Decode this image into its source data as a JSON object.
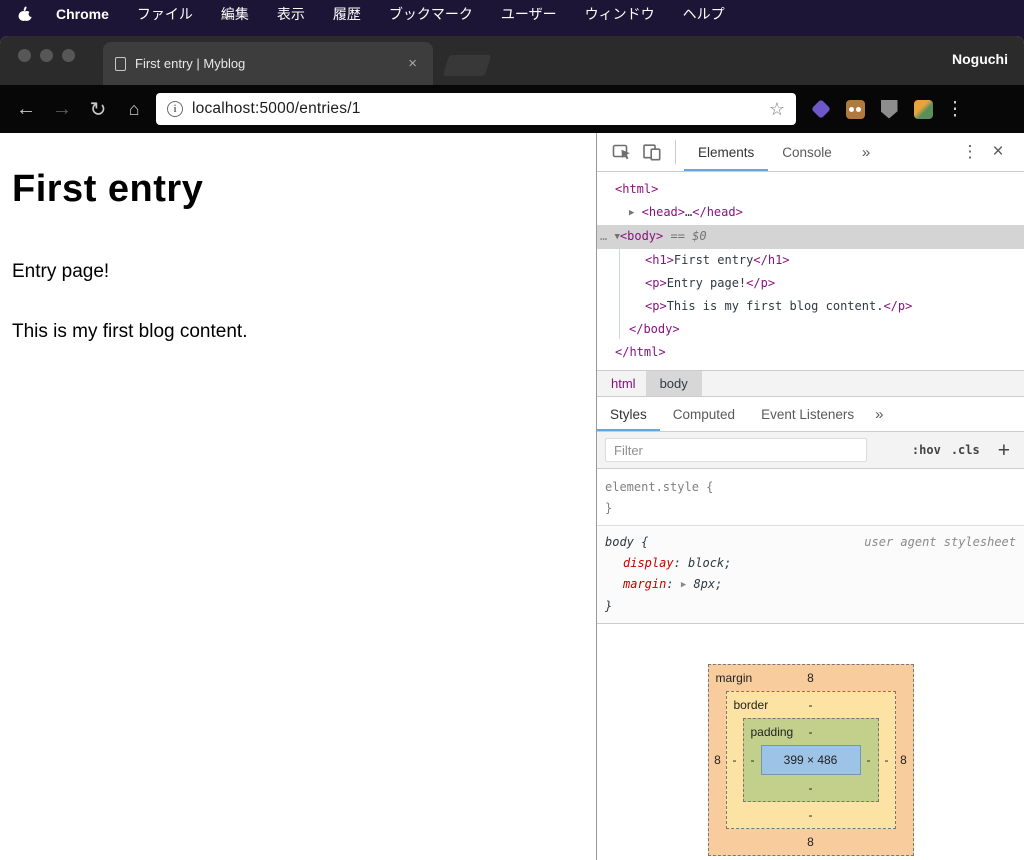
{
  "menubar": {
    "app_name": "Chrome",
    "items": [
      "ファイル",
      "編集",
      "表示",
      "履歴",
      "ブックマーク",
      "ユーザー",
      "ウィンドウ",
      "ヘルプ"
    ]
  },
  "window": {
    "tab_title": "First entry | Myblog",
    "tab_close": "×",
    "profile_name": "Noguchi"
  },
  "toolbar": {
    "url": "localhost:5000/entries/1",
    "icons": {
      "back": "←",
      "forward": "→",
      "reload": "↻",
      "home": "⌂",
      "info": "i",
      "star": "☆",
      "menu": "⋮"
    }
  },
  "page": {
    "title": "First entry",
    "paragraph1": "Entry page!",
    "paragraph2": "This is my first blog content."
  },
  "devtools": {
    "header": {
      "tab_elements": "Elements",
      "tab_console": "Console",
      "more": "»",
      "menu": "⋮",
      "close": "×"
    },
    "tree": {
      "html_open": "<html>",
      "head_arrow": "▶",
      "head_open": "<head>",
      "head_ellipsis": "…",
      "head_close": "</head>",
      "body_gutter": "…",
      "body_arrow": "▼",
      "body_open": "<body>",
      "body_hint": "== $0",
      "children": [
        {
          "open": "<h1>",
          "text": "First entry",
          "close": "</h1>"
        },
        {
          "open": "<p>",
          "text": "Entry page!",
          "close": "</p>"
        },
        {
          "open": "<p>",
          "text": "This is my first blog content.",
          "close": "</p>"
        }
      ],
      "body_close": "</body>",
      "html_close": "</html>"
    },
    "crumbs": [
      "html",
      "body"
    ],
    "styles_tabs": [
      "Styles",
      "Computed",
      "Event Listeners"
    ],
    "styles_more": "»",
    "filter": {
      "placeholder": "Filter",
      "hov": ":hov",
      "cls": ".cls",
      "plus": "+"
    },
    "element_style": {
      "selector": "element.style",
      "open": "{",
      "close": "}"
    },
    "body_rule": {
      "selector": "body {",
      "origin": "user agent stylesheet",
      "props": [
        {
          "name": "display",
          "colon": ": ",
          "value": "block;"
        },
        {
          "name": "margin",
          "colon": ": ",
          "arrow": "▶",
          "value": " 8px;"
        }
      ],
      "close": "}"
    },
    "box_model": {
      "margin_label": "margin",
      "border_label": "border",
      "padding_label": "padding",
      "content_text": "399 × 486",
      "margin": {
        "top": "8",
        "right": "8",
        "bottom": "8",
        "left": "8"
      },
      "border": {
        "top": "-",
        "right": "-",
        "bottom": "-",
        "left": "-"
      },
      "padding": {
        "top": "-",
        "right": "-",
        "bottom": "-",
        "left": "-"
      }
    },
    "colors": {
      "accent_tab_underline": "#62a7e6",
      "tag": "#881280",
      "property_name": "#c80000",
      "selection": "#d4d4d4"
    }
  }
}
